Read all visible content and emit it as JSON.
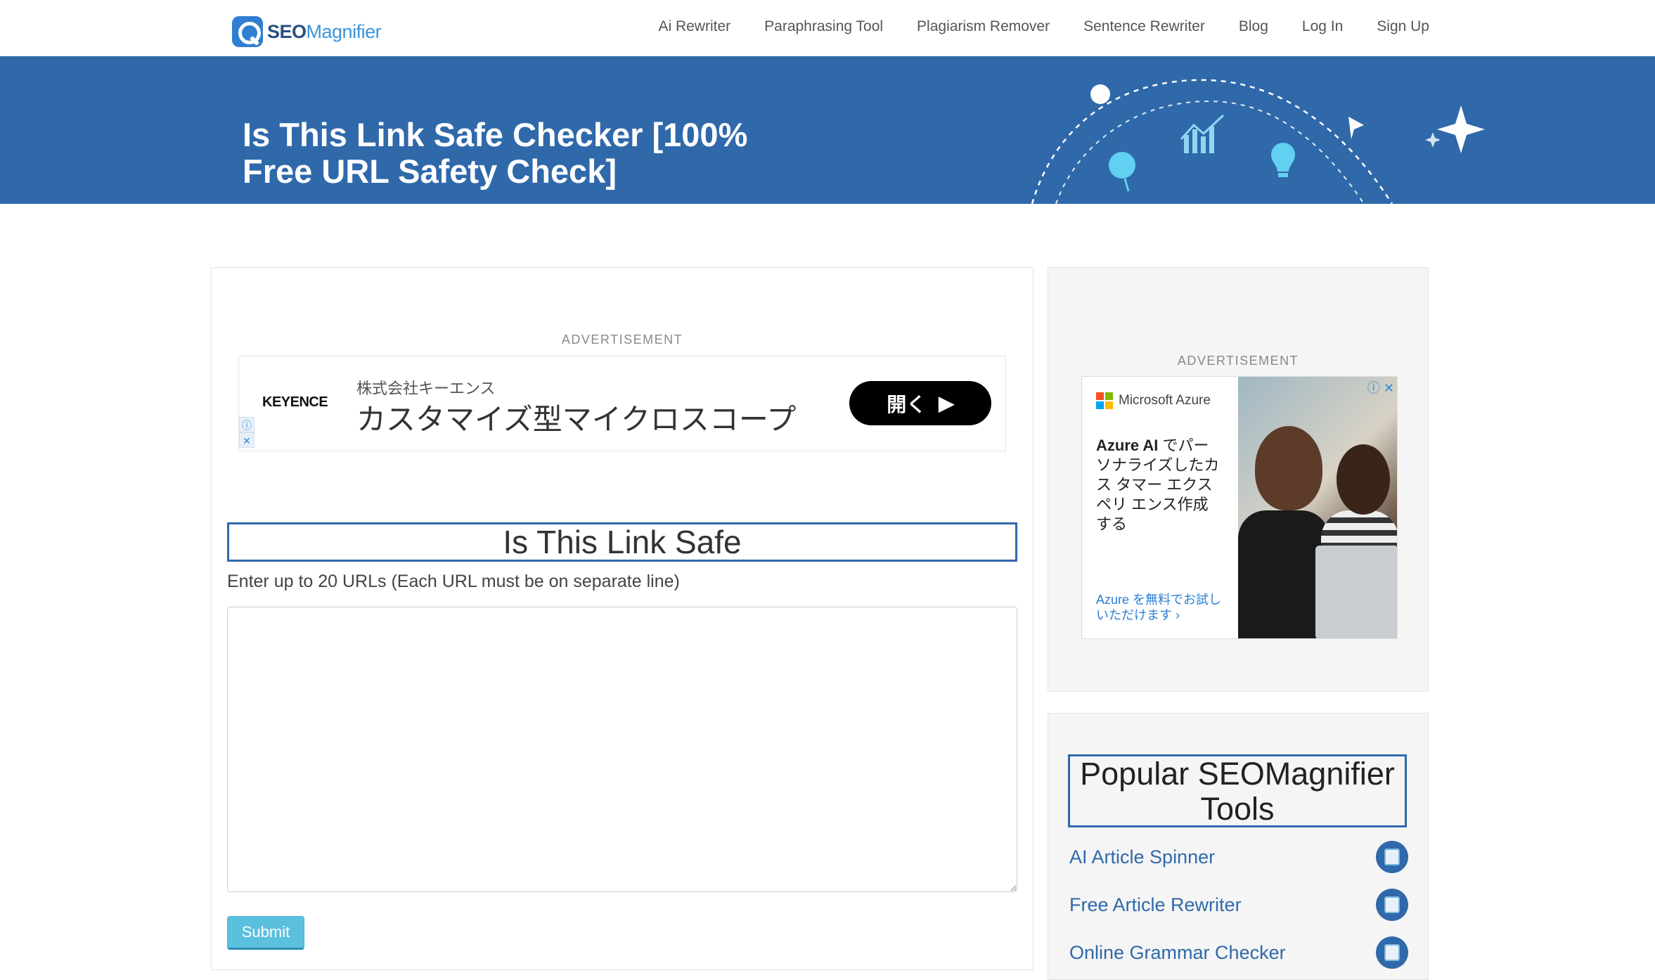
{
  "header": {
    "logo": {
      "seo": "SEO",
      "magnifier": "Magnifier"
    },
    "nav": [
      {
        "label": "Ai Rewriter"
      },
      {
        "label": "Paraphrasing Tool"
      },
      {
        "label": "Plagiarism Remover"
      },
      {
        "label": "Sentence Rewriter"
      },
      {
        "label": "Blog"
      },
      {
        "label": "Log In"
      },
      {
        "label": "Sign Up"
      }
    ]
  },
  "banner": {
    "title": "Is This Link Safe Checker [100% Free URL Safety Check]",
    "background_color": "#2f69aa"
  },
  "main": {
    "ad_label": "ADVERTISEMENT",
    "ad": {
      "brand": "KEYENCE",
      "subtitle": "株式会社キーエンス",
      "headline": "カスタマイズ型マイクロスコープ",
      "button": "開く"
    },
    "tool_title": "Is This Link Safe",
    "help_text": "Enter up to 20 URLs (Each URL must be on separate line)",
    "textarea_value": "",
    "submit_label": "Submit"
  },
  "sidebar": {
    "ad_label": "ADVERTISEMENT",
    "azure_ad": {
      "brand": "Microsoft Azure",
      "text_bold": "Azure AI",
      "text_rest": " でパーソナライズしたカス タマー エクスペリ エンス作成する",
      "cta": "Azure を無料でお試しいただけます ›"
    },
    "popular_title": "Popular SEOMagnifier Tools",
    "tools": [
      {
        "label": "AI Article Spinner"
      },
      {
        "label": "Free Article Rewriter"
      },
      {
        "label": "Online Grammar Checker"
      }
    ]
  }
}
